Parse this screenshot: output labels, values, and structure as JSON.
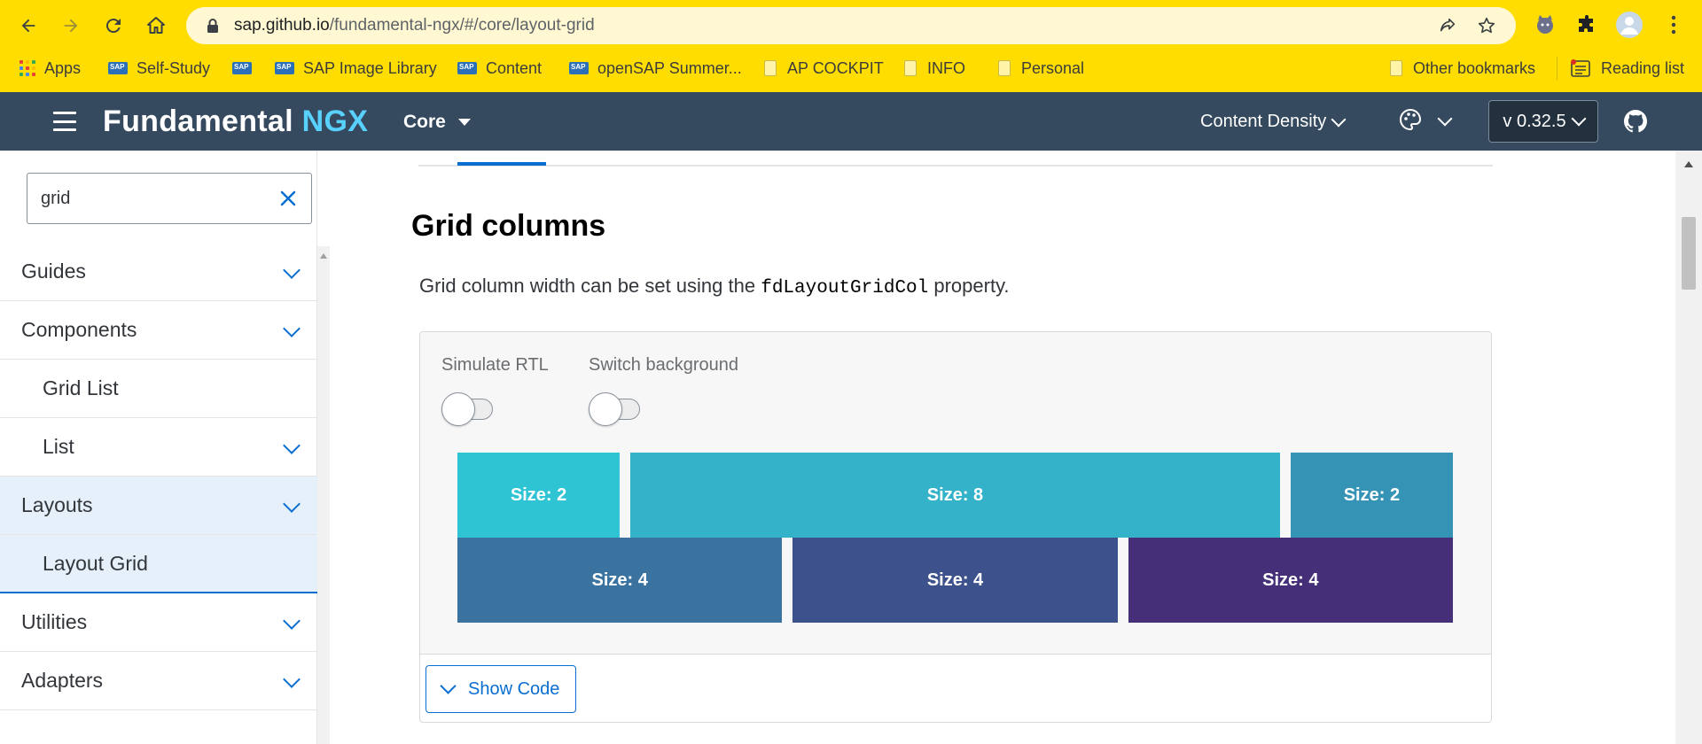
{
  "browser": {
    "url_host": "sap.github.io",
    "url_path": "/fundamental-ngx/#/core/layout-grid",
    "bookmarks": [
      "Apps",
      "Self-Study",
      "SAP Image Library",
      "Content",
      "openSAP Summer...",
      "AP COCKPIT",
      "INFO",
      "Personal"
    ],
    "other_bookmarks": "Other bookmarks",
    "reading_list": "Reading list"
  },
  "header": {
    "brand_main": "Fundamental",
    "brand_accent": "NGX",
    "core_menu": "Core",
    "content_density": "Content Density",
    "version": "v 0.32.5"
  },
  "sidebar": {
    "search_value": "grid",
    "items": [
      {
        "label": "Guides"
      },
      {
        "label": "Components"
      },
      {
        "label": "Grid List"
      },
      {
        "label": "List"
      },
      {
        "label": "Layouts"
      },
      {
        "label": "Layout Grid"
      },
      {
        "label": "Utilities"
      },
      {
        "label": "Adapters"
      }
    ]
  },
  "main": {
    "section_title": "Grid columns",
    "description_before": "Grid column width can be set using the ",
    "description_code": "fdLayoutGridCol",
    "description_after": " property.",
    "toggles": {
      "rtl_label": "Simulate RTL",
      "background_label": "Switch background"
    },
    "grid_rows": [
      [
        {
          "label": "Size: 2",
          "size": 2,
          "color": "#2ec4d4"
        },
        {
          "label": "Size: 8",
          "size": 8,
          "color": "#33b2c9"
        },
        {
          "label": "Size: 2",
          "size": 2,
          "color": "#3593b5"
        }
      ],
      [
        {
          "label": "Size: 4",
          "size": 4,
          "color": "#3a73a0"
        },
        {
          "label": "Size: 4",
          "size": 4,
          "color": "#3d528c"
        },
        {
          "label": "Size: 4",
          "size": 4,
          "color": "#442f78"
        }
      ]
    ],
    "show_code": "Show Code"
  },
  "colors": {
    "chrome_bg": "#ffdd00",
    "header_bg": "#354a5f",
    "accent": "#0a6ed1",
    "brand_accent": "#59d1ff"
  }
}
